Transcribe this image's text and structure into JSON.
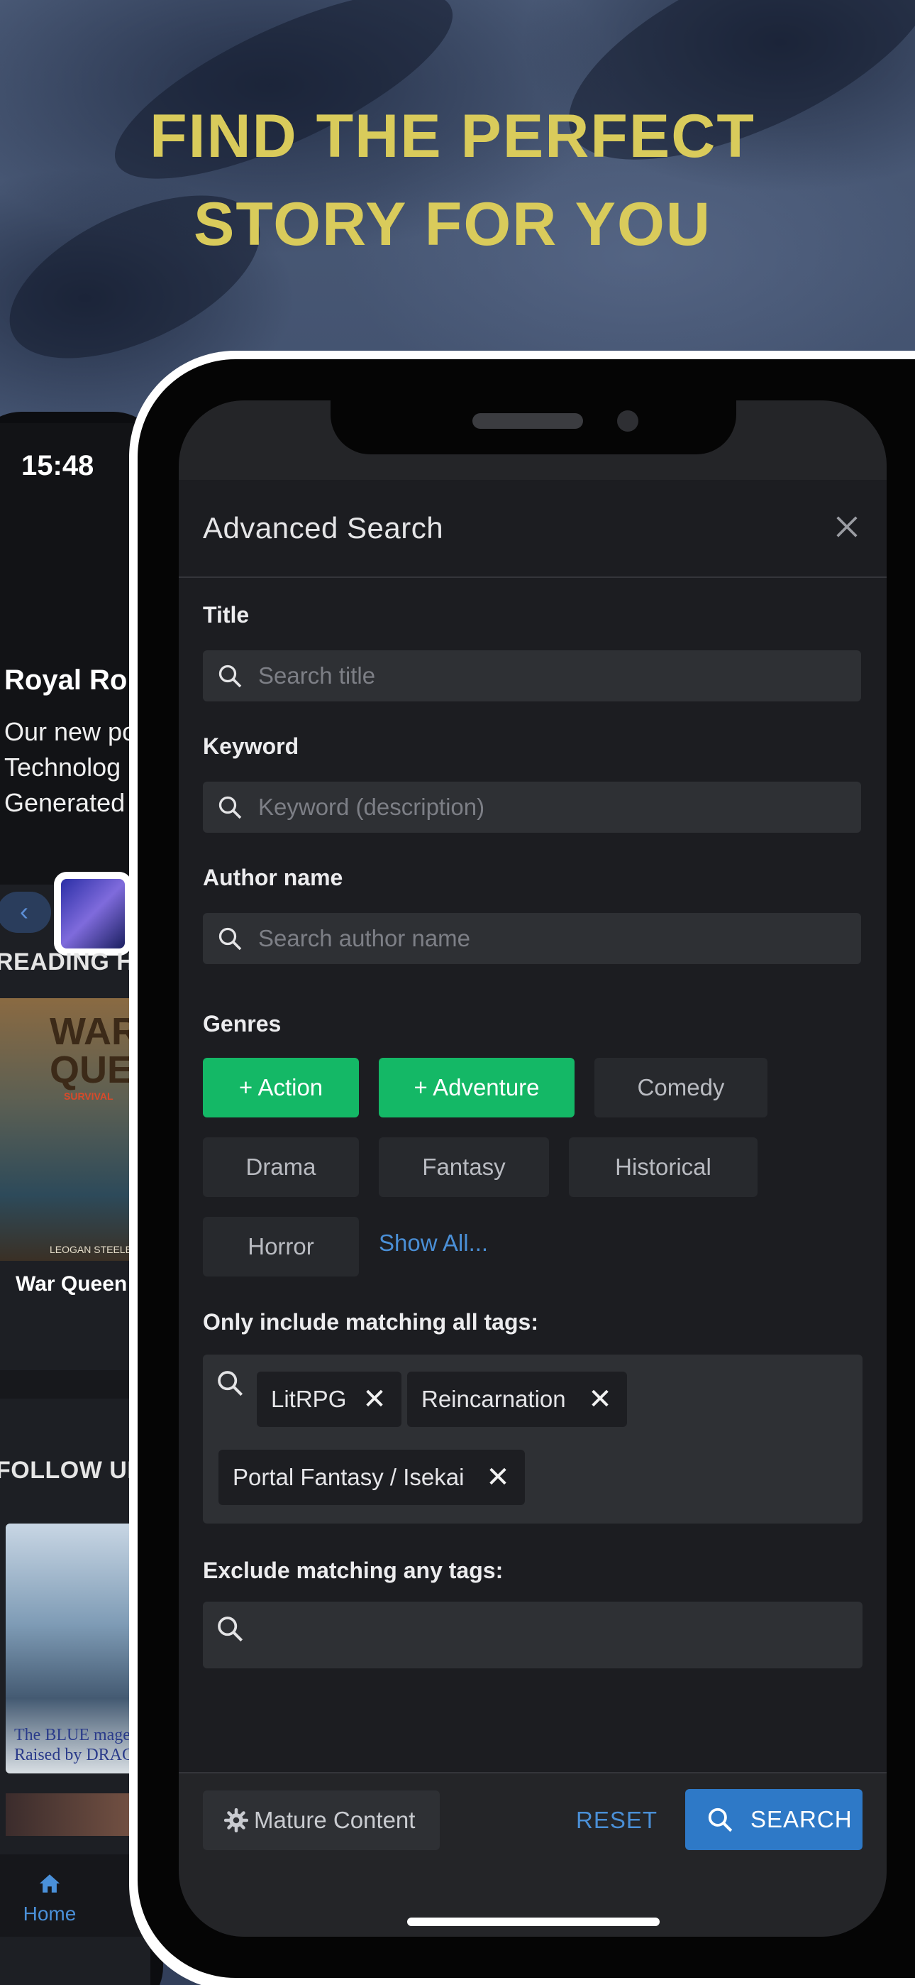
{
  "promo": {
    "headline_line1": "FIND THE PERFECT",
    "headline_line2": "STORY FOR YOU",
    "headline_color": "#d9cb5b"
  },
  "back_phone": {
    "status_time": "15:48",
    "hero_title": "Royal Ro",
    "hero_text": [
      "Our new po",
      "Technolog",
      "Generated"
    ],
    "prev_icon": "chevron-left-icon",
    "sections": [
      "READING HIS",
      "FOLLOW UP"
    ],
    "cover1_title": [
      "WAR",
      "QUEEN"
    ],
    "cover1_subtitle": "SURVIVAL",
    "cover1_author": "LEOGAN STEELE",
    "cover1_caption": "War Queen",
    "cover2_text": [
      "The BLUE mage",
      "Raised by DRAGO"
    ],
    "tab_home": "Home"
  },
  "modal": {
    "title": "Advanced Search",
    "close_icon": "close-icon",
    "title_field": {
      "label": "Title",
      "placeholder": "Search title",
      "value": ""
    },
    "keyword_field": {
      "label": "Keyword",
      "placeholder": "Keyword (description)",
      "value": ""
    },
    "author_field": {
      "label": "Author name",
      "placeholder": "Search author name",
      "value": ""
    },
    "genres": {
      "label": "Genres",
      "items": [
        {
          "label": "+ Action",
          "selected": true
        },
        {
          "label": "+ Adventure",
          "selected": true
        },
        {
          "label": "Comedy",
          "selected": false
        },
        {
          "label": "Drama",
          "selected": false
        },
        {
          "label": "Fantasy",
          "selected": false
        },
        {
          "label": "Historical",
          "selected": false
        },
        {
          "label": "Horror",
          "selected": false
        }
      ],
      "show_all": "Show All..."
    },
    "include_tags": {
      "label": "Only include matching all tags:",
      "tags": [
        "LitRPG",
        "Reincarnation",
        "Portal Fantasy / Isekai"
      ],
      "remove_symbol": "✕"
    },
    "exclude_tags": {
      "label": "Exclude matching any tags:",
      "tags": []
    },
    "footer": {
      "mature_content": "Mature Content",
      "reset": "RESET",
      "search": "SEARCH"
    }
  },
  "colors": {
    "selected_chip": "#14b866",
    "accent_blue": "#2e79c7",
    "link_blue": "#4a8fd6"
  }
}
